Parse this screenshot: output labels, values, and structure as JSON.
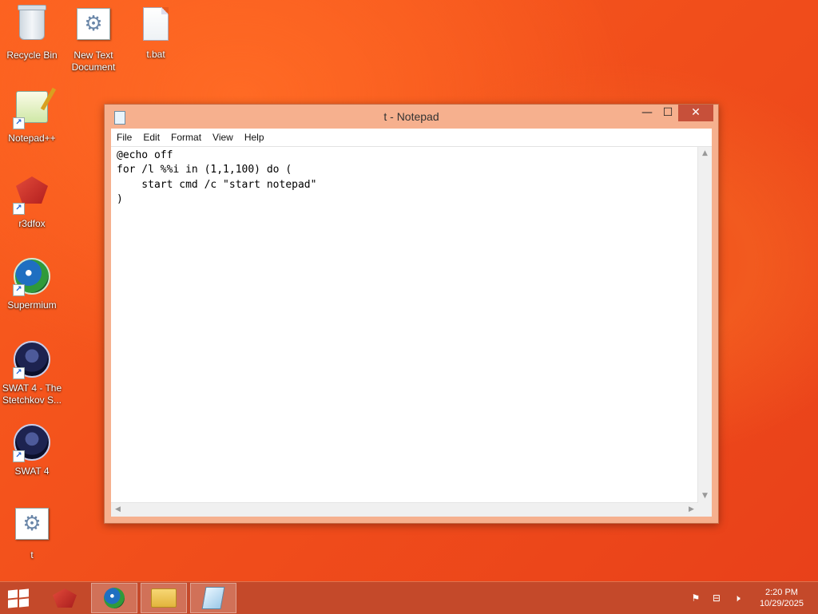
{
  "desktop": {
    "icons": [
      {
        "label": "Recycle Bin",
        "icon": "recycle-bin-icon"
      },
      {
        "label": "New Text Document",
        "icon": "gear-document-icon"
      },
      {
        "label": "t.bat",
        "icon": "text-file-icon"
      },
      {
        "label": "Notepad++",
        "icon": "notepad-plus-plus-icon"
      },
      {
        "label": "r3dfox",
        "icon": "r3dfox-icon"
      },
      {
        "label": "Supermium",
        "icon": "supermium-icon"
      },
      {
        "label": "SWAT 4 - The Stetchkov S...",
        "icon": "swat4-icon"
      },
      {
        "label": "SWAT 4",
        "icon": "swat4-icon"
      },
      {
        "label": "t",
        "icon": "gear-document-icon"
      }
    ]
  },
  "notepad": {
    "title": "t - Notepad",
    "menu": [
      "File",
      "Edit",
      "Format",
      "View",
      "Help"
    ],
    "content": "@echo off\nfor /l %%i in (1,1,100) do (\n    start cmd /c \"start notepad\"\n)",
    "buttons": {
      "minimize": "—",
      "maximize": "☐",
      "close": "✕"
    }
  },
  "taskbar": {
    "pinned": [
      "r3dfox-icon",
      "supermium-icon",
      "file-explorer-icon",
      "notepad-icon"
    ],
    "tray": {
      "flag": "⚑",
      "network": "⊟",
      "volume": "🕨"
    },
    "clock_time": "2:20 PM",
    "clock_date": "10/29/2025"
  },
  "colors": {
    "accent": "#f05a1f",
    "taskbar": "#c4492a",
    "titlebar": "#f6b08e",
    "close": "#c7503a"
  }
}
